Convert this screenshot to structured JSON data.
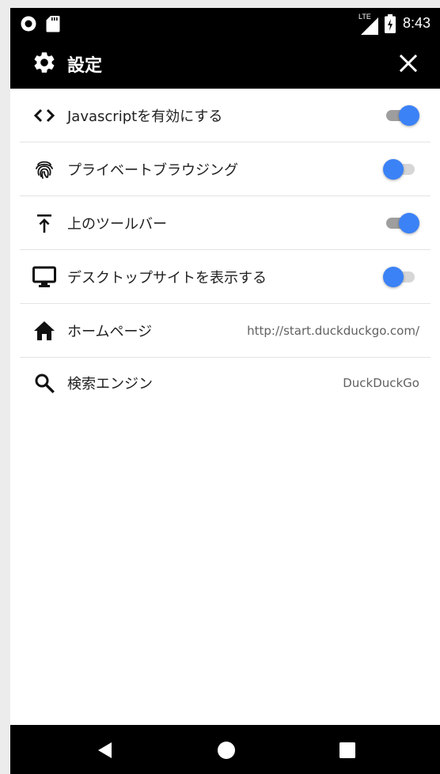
{
  "status_bar": {
    "network": "LTE",
    "time": "8:43"
  },
  "app_bar": {
    "title": "設定"
  },
  "settings": [
    {
      "label": "Javascriptを有効にする",
      "icon": "code-icon",
      "control": "toggle",
      "on": true
    },
    {
      "label": "プライベートブラウジング",
      "icon": "fingerprint-icon",
      "control": "toggle",
      "on": false
    },
    {
      "label": "上のツールバー",
      "icon": "vertical-align-top-icon",
      "control": "toggle",
      "on": true
    },
    {
      "label": "デスクトップサイトを表示する",
      "icon": "desktop-icon",
      "control": "toggle",
      "on": false
    },
    {
      "label": "ホームページ",
      "icon": "home-icon",
      "control": "value",
      "value": "http://start.duckduckgo.com/"
    },
    {
      "label": "検索エンジン",
      "icon": "search-icon",
      "control": "value",
      "value": "DuckDuckGo"
    }
  ],
  "colors": {
    "accent": "#3b82f6",
    "bar": "#000000"
  }
}
